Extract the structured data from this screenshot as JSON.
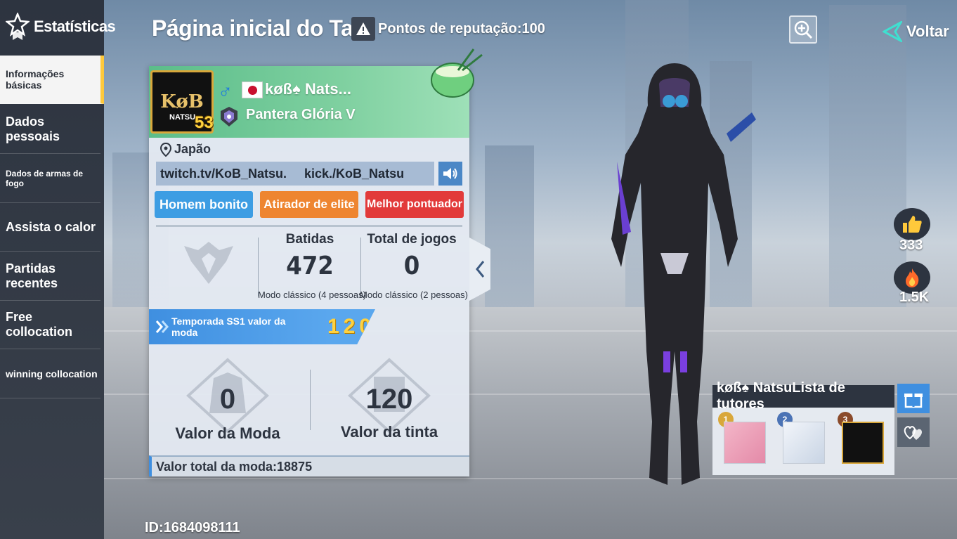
{
  "sidebar": {
    "title": "Estatísticas",
    "items": [
      {
        "label": "Informações básicas"
      },
      {
        "label": "Dados pessoais"
      },
      {
        "label": "Dados de armas de fogo"
      },
      {
        "label": "Assista o calor"
      },
      {
        "label": "Partidas recentes"
      },
      {
        "label": "Free collocation"
      },
      {
        "label": "winning collocation"
      }
    ]
  },
  "header": {
    "title": "Página inicial do Ta",
    "reputation": "Pontos de reputação:100",
    "back_label": "Voltar"
  },
  "profile": {
    "badge_text": "KøB",
    "badge_sub": "NATSU",
    "level": "53",
    "name": "køß♠ Nats...",
    "rank": "Pantera Glória V",
    "location": "Japão",
    "links": "twitch.tv/KoB_Natsu.     kick./KoB_Natsu",
    "tags": [
      "Homem bonito",
      "Atirador de elite",
      "Melhor pontuador"
    ]
  },
  "stats": {
    "kills_title": "Batidas",
    "kills_value": "472",
    "kills_mode": "Modo clássico (4 pessoas)",
    "games_title": "Total de jogos",
    "games_value": "0",
    "games_mode": "Modo clássico (2 pessoas)"
  },
  "season": {
    "label": "Temporada SS1 valor da moda",
    "value": "120"
  },
  "fashion": {
    "fashion_value": "0",
    "fashion_label": "Valor da Moda",
    "paint_value": "120",
    "paint_label": "Valor da tinta",
    "total": "Valor total da moda:18875"
  },
  "social": {
    "likes": "333",
    "heat": "1.5K"
  },
  "mentors": {
    "title": "køß♠ NatsuLista de tutores",
    "ranks": [
      "1",
      "2",
      "3"
    ]
  },
  "player_id": "ID:1684098111",
  "colors": {
    "accent_blue": "#3f8fe0",
    "tag_orange": "#ee8530",
    "tag_red": "#e23a3a",
    "card_green": "#5bbd8a",
    "active_marker": "#ffc93b"
  }
}
